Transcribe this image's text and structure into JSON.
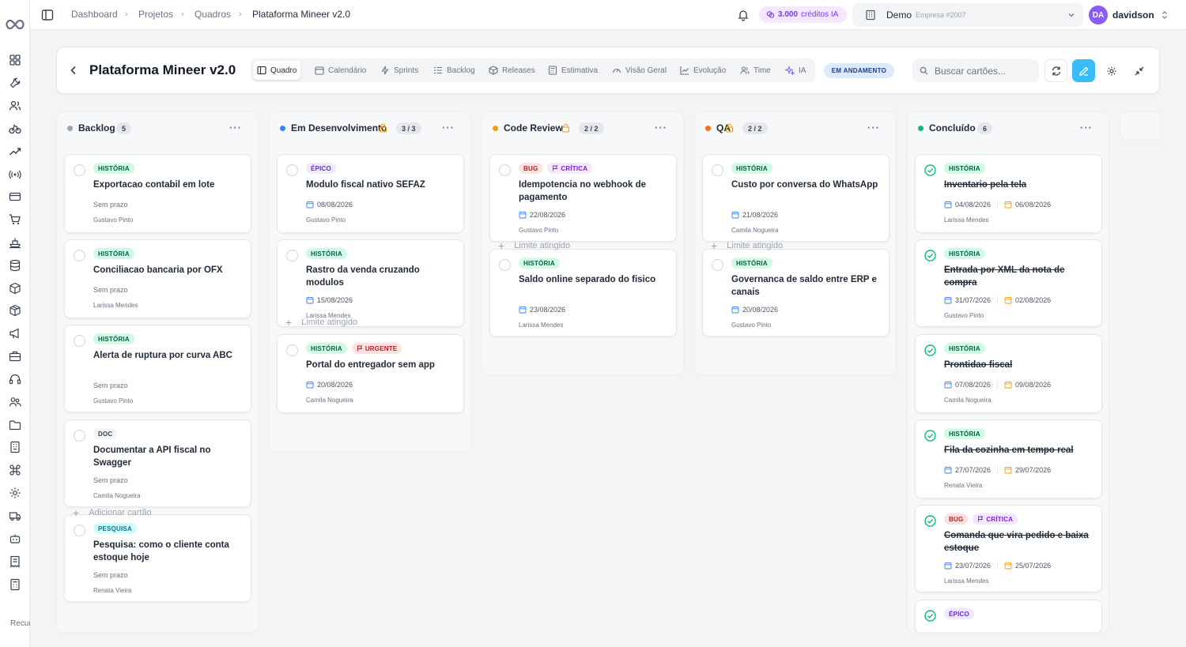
{
  "sidebar": {
    "logo": "infinity-logo",
    "icons": [
      "grid-icon",
      "wrench-icon",
      "users-icon",
      "bike-icon",
      "trend-icon",
      "broadcast-icon",
      "card-icon",
      "cart-icon",
      "ship-icon",
      "database-icon",
      "box-icon",
      "package-icon",
      "megaphone-icon",
      "briefcase-icon",
      "headset-icon",
      "team-icon",
      "folder-icon",
      "building-icon",
      "command-icon",
      "gear-icon",
      "truck-icon",
      "bot-icon",
      "receipt-icon",
      "calculator-icon"
    ],
    "footer_text": "Recursos avançados"
  },
  "topbar": {
    "breadcrumb": [
      "Dashboard",
      "Projetos",
      "Quadros",
      "Plataforma Mineer v2.0"
    ],
    "credits_amount": "3.000",
    "credits_label": "créditos IA",
    "company_name": "Demo",
    "company_sub": "Empresa #2007",
    "user_initials": "DA",
    "user_name": "davidson"
  },
  "header": {
    "title": "Plataforma Mineer v2.0",
    "tabs": [
      "Quadro",
      "Calendário",
      "Sprints",
      "Backlog",
      "Releases",
      "Estimativa",
      "Visão Geral",
      "Evolução",
      "Time",
      "IA"
    ],
    "active_tab": "Quadro",
    "status": "EM ANDAMENTO",
    "search_placeholder": "Buscar cartões..."
  },
  "colors": {
    "backlog": "#9ca3af",
    "dev": "#3b82f6",
    "review": "#f59e0b",
    "qa": "#f97316",
    "done": "#10b981",
    "accent": "#38bdf8"
  },
  "columns": [
    {
      "name": "Backlog",
      "count": "5",
      "cards": [
        {
          "tags": [
            "HISTÓRIA"
          ],
          "title": "Exportacao contabil em lote",
          "due": "Sem prazo",
          "assignee": "Gustavo Pinto"
        },
        {
          "tags": [
            "HISTÓRIA"
          ],
          "title": "Conciliacao bancaria por OFX",
          "due": "Sem prazo",
          "assignee": "Larissa Mendes"
        },
        {
          "tags": [
            "HISTÓRIA"
          ],
          "title": "Alerta de ruptura por curva ABC",
          "due": "Sem prazo",
          "assignee": "Gustavo Pinto"
        },
        {
          "tags": [
            "DOC"
          ],
          "title": "Documentar a API fiscal no Swagger",
          "due": "Sem prazo",
          "assignee": "Camila Nogueira"
        },
        {
          "tags": [
            "PESQUISA"
          ],
          "title": "Pesquisa: como o cliente conta estoque hoje",
          "due": "Sem prazo",
          "assignee": "Renata Vieira"
        }
      ],
      "footer": "Adicionar cartão"
    },
    {
      "name": "Em Desenvolvimento",
      "count": "3 / 3",
      "cards": [
        {
          "tags": [
            "ÉPICO"
          ],
          "title": "Modulo fiscal nativo SEFAZ",
          "date": "08/08/2026",
          "assignee": "Gustavo Pinto"
        },
        {
          "tags": [
            "HISTÓRIA"
          ],
          "title": "Rastro da venda cruzando modulos",
          "date": "15/08/2026",
          "assignee": "Larissa Mendes"
        },
        {
          "tags": [
            "HISTÓRIA",
            "URGENTE"
          ],
          "title": "Portal do entregador sem app",
          "date": "20/08/2026",
          "assignee": "Camila Nogueira"
        }
      ],
      "footer": "Limite atingido"
    },
    {
      "name": "Code Review",
      "count": "2 / 2",
      "cards": [
        {
          "tags": [
            "BUG",
            "CRÍTICA"
          ],
          "title": "Idempotencia no webhook de pagamento",
          "date": "22/08/2026",
          "assignee": "Gustavo Pinto"
        },
        {
          "tags": [
            "HISTÓRIA"
          ],
          "title": "Saldo online separado do fisico",
          "date": "23/08/2026",
          "assignee": "Larissa Mendes"
        }
      ],
      "footer": "Limite atingido"
    },
    {
      "name": "QA",
      "count": "2 / 2",
      "cards": [
        {
          "tags": [
            "HISTÓRIA"
          ],
          "title": "Custo por conversa do WhatsApp",
          "date": "21/08/2026",
          "assignee": "Camila Nogueira"
        },
        {
          "tags": [
            "HISTÓRIA"
          ],
          "title": "Governanca de saldo entre ERP e canais",
          "date": "20/08/2026",
          "assignee": "Gustavo Pinto"
        }
      ],
      "footer": "Limite atingido"
    },
    {
      "name": "Concluído",
      "count": "6",
      "cards": [
        {
          "tags": [
            "HISTÓRIA"
          ],
          "title": "Inventario pela tela",
          "date": "04/08/2026",
          "date2": "06/08/2026",
          "assignee": "Larissa Mendes"
        },
        {
          "tags": [
            "HISTÓRIA"
          ],
          "title": "Entrada por XML da nota de compra",
          "date": "31/07/2026",
          "date2": "02/08/2026",
          "assignee": "Gustavo Pinto"
        },
        {
          "tags": [
            "HISTÓRIA"
          ],
          "title": "Prontidao fiscal",
          "date": "07/08/2026",
          "date2": "09/08/2026",
          "assignee": "Camila Nogueira"
        },
        {
          "tags": [
            "HISTÓRIA"
          ],
          "title": "Fila da cozinha em tempo real",
          "date": "27/07/2026",
          "date2": "29/07/2026",
          "assignee": "Renata Vieira"
        },
        {
          "tags": [
            "BUG",
            "CRÍTICA"
          ],
          "title": "Comanda que vira pedido e baixa estoque",
          "date": "23/07/2026",
          "date2": "25/07/2026",
          "assignee": "Larissa Mendes"
        },
        {
          "tags": [
            "ÉPICO"
          ]
        }
      ]
    }
  ]
}
